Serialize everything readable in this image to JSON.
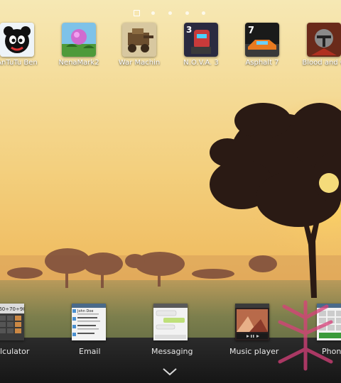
{
  "home": {
    "page_count": 5,
    "active_page": 0,
    "apps": [
      {
        "label": "AnTuTu Ben",
        "icon": "antutu-icon"
      },
      {
        "label": "NenaMark2",
        "icon": "nenamark-icon"
      },
      {
        "label": "War Machin",
        "icon": "war-machine-icon"
      },
      {
        "label": "N.O.V.A. 3",
        "icon": "nova3-icon"
      },
      {
        "label": "Asphalt 7",
        "icon": "asphalt7-icon"
      },
      {
        "label": "Blood and G",
        "icon": "blood-and-glory-icon"
      }
    ]
  },
  "recent": {
    "items": [
      {
        "label": "Calculator",
        "shown": "lculator",
        "thumb_text": "0÷60÷70÷90"
      },
      {
        "label": "Email",
        "shown": "Email",
        "thumb_text": "John Doe"
      },
      {
        "label": "Messaging",
        "shown": "Messaging",
        "thumb_text": ""
      },
      {
        "label": "Music player",
        "shown": "Music player",
        "thumb_text": ""
      },
      {
        "label": "Phone",
        "shown": "Phon",
        "thumb_text": ""
      }
    ]
  },
  "colors": {
    "sky_top": "#f5e3a6",
    "sky_mid": "#f0c56a",
    "sun": "#ffd35a",
    "ground": "#5c6a45",
    "tray": "#1e1e1e"
  }
}
